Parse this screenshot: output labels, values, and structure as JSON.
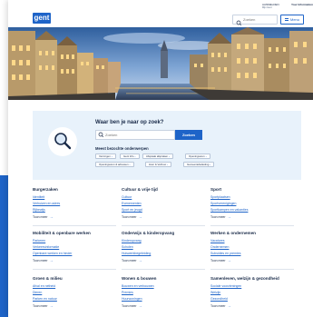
{
  "header": {
    "logo": "gent",
    "search_placeholder": "Zoeken",
    "menu_label": "Menu",
    "login_label": "AANMELDEN",
    "login_sub": "Mijn Gent",
    "language_label": "Your Information"
  },
  "search_panel": {
    "title": "Waar ben je naar op zoek?",
    "input_placeholder": "Zoeken",
    "button_label": "Zoeken",
    "subtitle": "Meest bezochte onderwerpen",
    "chips": [
      "Verzorgen",
      "Gent Info",
      "Afspraak afspraken",
      "Openingsuren",
      "Openingsuren & adressen",
      "Huur & Verhuur",
      "Gemeentebelasting"
    ]
  },
  "topics": [
    {
      "title": "Burgerzaken",
      "links": [
        "Identiteit",
        "Verhuizen en adres",
        "Rijbewijs"
      ],
      "more": "Toon meer"
    },
    {
      "title": "Cultuur & vrije tijd",
      "links": [
        "Cultuur",
        "Evenementen",
        "Sport en jeugd"
      ],
      "more": "Toon meer"
    },
    {
      "title": "Sport",
      "links": [
        "Sportplaatsen",
        "Sportverenigingen",
        "Sportkampen en vakanties"
      ],
      "more": "Toon meer"
    },
    {
      "title": "Mobiliteit & openbare werken",
      "links": [
        "Parkeren",
        "Verkeersinformatie",
        "Openbare werken en hinder"
      ],
      "more": "Toon meer"
    },
    {
      "title": "Onderwijs & kinderopvang",
      "links": [
        "Kinderopvang",
        "Scholen",
        "Huiswerkbegeleiding"
      ],
      "more": "Toon meer"
    },
    {
      "title": "Werken & ondernemen",
      "links": [
        "Vacatures",
        "Ondernemen",
        "Subsidies en premies"
      ],
      "more": "Toon meer"
    },
    {
      "title": "Groen & milieu",
      "links": [
        "Afval en netheid",
        "Dieren",
        "Parken en natuur"
      ],
      "more": "Toon meer"
    },
    {
      "title": "Wonen & bouwen",
      "links": [
        "Bouwen en verbouwen",
        "Premies",
        "Huurwoningen"
      ],
      "more": "Toon meer"
    },
    {
      "title": "Samenleven, welzijn & gezondheid",
      "links": [
        "Sociale voorzieningen",
        "Welzijn",
        "Gezondheid"
      ],
      "more": "Toon meer"
    }
  ],
  "colors": {
    "brand_blue": "#1e64c8",
    "panel_bg": "#e8f2fb",
    "text_dark": "#1a2b49"
  }
}
